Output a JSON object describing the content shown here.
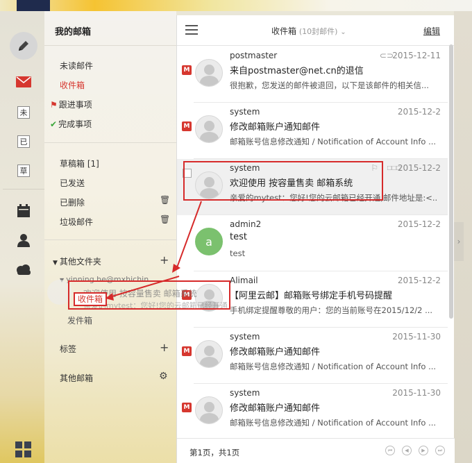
{
  "colors": {
    "accent_red": "#d6372f",
    "done_green": "#3aa63a",
    "nav_dark": "#1f2b4d"
  },
  "rail": {
    "compose_icon": "pencil-icon",
    "mail_icon": "mail-icon",
    "unread_label": "未",
    "read_label": "已",
    "draft_label": "草",
    "calendar_icon": "calendar-icon",
    "contacts_icon": "person-icon",
    "cloud_icon": "cloud-icon",
    "apps_icon": "grid-icon"
  },
  "folders": {
    "title": "我的邮箱",
    "items_top": [
      "未读邮件",
      "收件箱",
      "跟进事项",
      "完成事项"
    ],
    "items_mid": [
      "草稿箱 [1]",
      "已发送",
      "已删除",
      "垃圾邮件"
    ],
    "other_folders": "其他文件夹",
    "account_label": "yinning.he@mxhichin",
    "sent_label": "发件箱",
    "tags_label": "标签",
    "other_mailbox_label": "其他邮箱"
  },
  "list": {
    "title": "收件箱",
    "count": "(10封邮件)",
    "edit": "编辑",
    "mails": [
      {
        "sender": "postmaster",
        "date": "2015-12-11",
        "subject": "来自postmaster@net.cn的退信",
        "preview": "很抱歉，您发送的邮件被退回，以下是该邮件的相关信..."
      },
      {
        "sender": "system",
        "date": "2015-12-2",
        "subject": "修改邮箱账户通知邮件",
        "preview": "邮箱账号信息修改通知 / Notification of Account Info ..."
      },
      {
        "sender": "system",
        "date": "2015-12-2",
        "subject": "欢迎使用 按容量售卖 邮箱系统",
        "preview": "亲爱的mytest：您好!您的云邮箱已经开通,邮件地址是:<..."
      },
      {
        "sender": "admin2",
        "avatar_letter": "a",
        "date": "2015-12-2",
        "subject": "test",
        "preview": "test"
      },
      {
        "sender": "Alimail",
        "date": "2015-12-2",
        "subject": "【阿里云邮】邮箱账号绑定手机号码提醒",
        "preview": "手机绑定提醒尊敬的用户：您的当前账号在2015/12/2 ..."
      },
      {
        "sender": "system",
        "date": "2015-11-30",
        "subject": "修改邮箱账户通知邮件",
        "preview": "邮箱账号信息修改通知 / Notification of Account Info ..."
      },
      {
        "sender": "system",
        "date": "2015-11-30",
        "subject": "修改邮箱账户通知邮件",
        "preview": "邮箱账号信息修改通知 / Notification of Account Info ..."
      }
    ],
    "page_info": "第1页，共1页"
  },
  "drag": {
    "ghost_subject": "欢迎使用 按容量售卖 邮箱系统",
    "ghost_preview": "亲爱的mytest：您好!您的云邮箱已经开通",
    "target_folder": "收件箱"
  }
}
